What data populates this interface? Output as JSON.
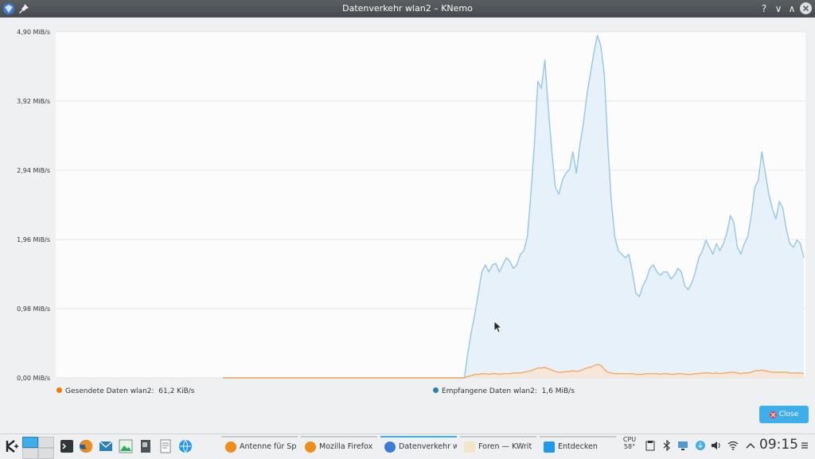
{
  "window": {
    "title": "Datenverkehr wlan2 – KNemo"
  },
  "titlebar_buttons": {
    "help": "?",
    "minimize": "∨",
    "maximize": "∧"
  },
  "chart_data": {
    "type": "area",
    "ylabels": [
      "4,90 MiB/s",
      "3,92 MiB/s",
      "2,94 MiB/s",
      "1,96 MiB/s",
      "0,98 MiB/s",
      "0,00 MiB/s"
    ],
    "ylim": [
      0,
      4.9
    ],
    "grid": true,
    "series": [
      {
        "name": "Empfangene Daten wlan2",
        "color": "#95c6ea",
        "fill": "#e3eff9",
        "values": [
          0,
          0,
          0,
          0,
          0,
          0,
          0,
          0,
          0,
          0,
          0,
          0,
          0,
          0,
          0,
          0,
          0,
          0,
          0,
          0,
          0,
          0,
          0,
          0,
          0,
          0,
          0,
          0,
          0,
          0,
          0,
          0,
          0,
          0,
          0,
          0,
          0,
          0,
          0,
          0,
          0,
          0,
          0,
          0,
          0,
          0,
          0,
          0,
          0,
          0,
          0,
          0,
          0,
          0,
          0,
          0,
          0,
          0,
          0,
          0,
          0,
          0,
          0,
          0,
          0,
          0,
          0,
          0,
          0,
          0,
          0.35,
          0.65,
          0.9,
          1.2,
          1.5,
          1.6,
          1.5,
          1.6,
          1.62,
          1.5,
          1.6,
          1.7,
          1.65,
          1.55,
          1.6,
          1.75,
          1.8,
          2.0,
          2.6,
          3.3,
          4.2,
          4.1,
          4.5,
          3.8,
          3.2,
          2.7,
          2.6,
          2.8,
          2.9,
          2.95,
          3.2,
          2.9,
          3.3,
          3.6,
          4.0,
          4.3,
          4.6,
          4.85,
          4.7,
          4.3,
          3.3,
          2.5,
          2.0,
          1.8,
          1.75,
          1.7,
          1.75,
          1.5,
          1.2,
          1.15,
          1.3,
          1.4,
          1.55,
          1.6,
          1.5,
          1.45,
          1.5,
          1.5,
          1.4,
          1.45,
          1.55,
          1.5,
          1.3,
          1.25,
          1.35,
          1.5,
          1.7,
          1.8,
          1.95,
          1.85,
          1.75,
          1.9,
          1.8,
          1.9,
          2.05,
          2.3,
          2.2,
          1.85,
          1.75,
          1.9,
          2.0,
          2.3,
          2.7,
          2.8,
          3.2,
          2.9,
          2.6,
          2.4,
          2.25,
          2.5,
          2.4,
          2.1,
          1.9,
          1.85,
          1.95,
          1.9,
          1.7
        ]
      },
      {
        "name": "Gesendete Daten wlan2",
        "color": "#f5a860",
        "fill": "#f7e6d6",
        "values": [
          0,
          0,
          0,
          0,
          0,
          0,
          0,
          0,
          0,
          0,
          0,
          0,
          0,
          0,
          0,
          0,
          0,
          0,
          0,
          0,
          0,
          0,
          0,
          0,
          0,
          0,
          0,
          0,
          0,
          0,
          0,
          0,
          0,
          0,
          0,
          0,
          0,
          0,
          0,
          0,
          0,
          0,
          0,
          0,
          0,
          0,
          0,
          0,
          0,
          0,
          0,
          0,
          0,
          0,
          0,
          0,
          0,
          0,
          0,
          0,
          0,
          0,
          0,
          0,
          0,
          0,
          0,
          0,
          0,
          0,
          0.02,
          0.03,
          0.05,
          0.05,
          0.06,
          0.06,
          0.05,
          0.06,
          0.06,
          0.05,
          0.06,
          0.06,
          0.06,
          0.07,
          0.07,
          0.07,
          0.08,
          0.09,
          0.1,
          0.12,
          0.14,
          0.14,
          0.15,
          0.13,
          0.11,
          0.09,
          0.08,
          0.08,
          0.09,
          0.09,
          0.1,
          0.09,
          0.1,
          0.12,
          0.14,
          0.15,
          0.17,
          0.19,
          0.18,
          0.12,
          0.08,
          0.07,
          0.06,
          0.06,
          0.06,
          0.06,
          0.06,
          0.06,
          0.05,
          0.05,
          0.05,
          0.06,
          0.06,
          0.06,
          0.06,
          0.05,
          0.06,
          0.06,
          0.05,
          0.05,
          0.06,
          0.06,
          0.05,
          0.05,
          0.05,
          0.06,
          0.06,
          0.07,
          0.07,
          0.07,
          0.06,
          0.07,
          0.06,
          0.07,
          0.07,
          0.08,
          0.08,
          0.07,
          0.06,
          0.07,
          0.07,
          0.08,
          0.1,
          0.1,
          0.11,
          0.1,
          0.09,
          0.08,
          0.08,
          0.08,
          0.08,
          0.08,
          0.07,
          0.07,
          0.07,
          0.07,
          0.06
        ]
      }
    ]
  },
  "legend": {
    "sent_label": "Gesendete Daten wlan2:",
    "sent_value": "61,2 KiB/s",
    "recv_label": "Empfangene Daten wlan2:",
    "recv_value": "1,6 MiB/s"
  },
  "close_label": "Close",
  "taskbar": {
    "tasks": [
      "Antenne für Sp",
      "Mozilla Firefox",
      "Datenverkehr w",
      "Foren — KWrit",
      "Entdecken"
    ],
    "cpu_label": "CPU",
    "cpu_temp": "58°",
    "clock": "09:15"
  },
  "colors": {
    "accent": "#3daee9",
    "titlebar": "#4d5256",
    "close": "#da4453"
  }
}
